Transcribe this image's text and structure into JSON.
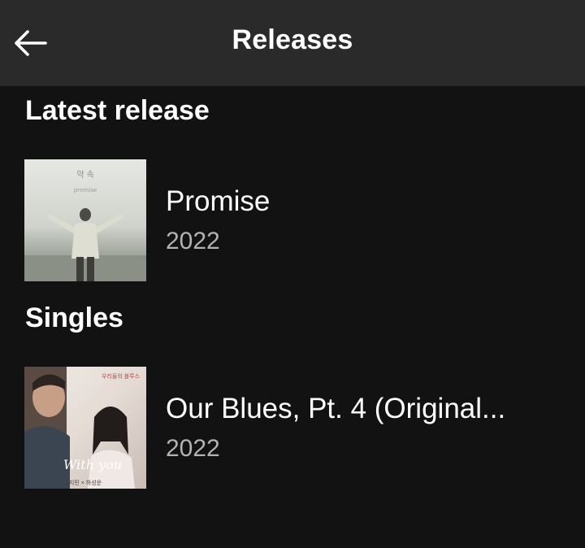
{
  "header": {
    "title": "Releases",
    "back_icon": "arrow-left-icon"
  },
  "sections": {
    "latest": {
      "heading": "Latest release",
      "item": {
        "title": "Promise",
        "year": "2022",
        "cover_text": "약 속",
        "cover_subtitle": "promise"
      }
    },
    "singles": {
      "heading": "Singles",
      "item": {
        "title": "Our Blues, Pt. 4 (Original...",
        "year": "2022",
        "cover_text": "With you",
        "cover_badge": "우리들의 블루스",
        "cover_artists": "지민 × 하성운"
      }
    }
  },
  "colors": {
    "background": "#121212",
    "header_bg": "#2a2a2a",
    "text": "#ffffff",
    "secondary_text": "#b3b3b3"
  }
}
